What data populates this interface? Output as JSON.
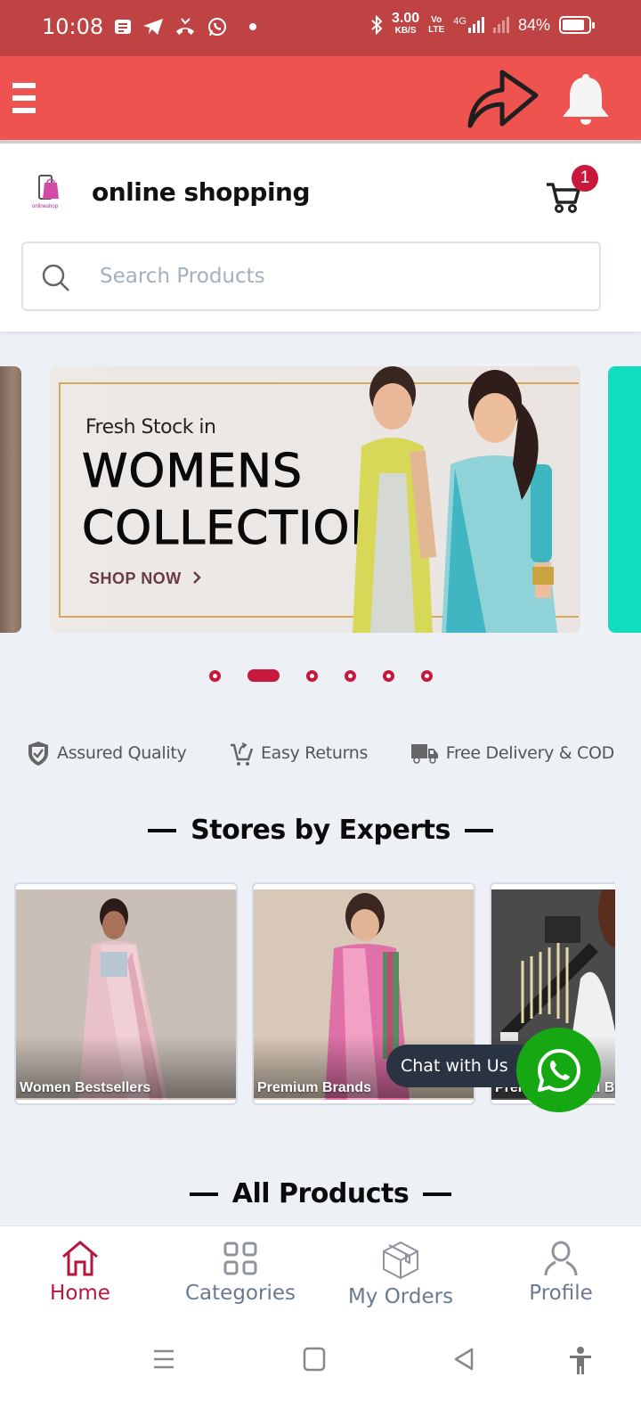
{
  "status_bar": {
    "time": "10:08",
    "notification_icons": [
      "message-icon",
      "telegram-icon",
      "missed-call-icon",
      "whatsapp-icon",
      "dot-icon"
    ],
    "net_speed_value": "3.00",
    "net_speed_unit": "KB/S",
    "volte_top": "Vo",
    "volte_bottom": "LTE",
    "network_type": "4G",
    "battery": "84%",
    "battery_level": 0.84
  },
  "app_bar": {
    "menu_icon": "hamburger-menu-icon",
    "share_icon": "share-arrow-icon",
    "bell_icon": "notification-bell-icon"
  },
  "header": {
    "logo_text": "onlineshop",
    "brand_title": "online shopping",
    "cart_count": "1",
    "search_placeholder": "Search Products",
    "search_value": ""
  },
  "banner": {
    "subtitle": "Fresh Stock in",
    "title_line1": "WOMENS",
    "title_line2": "COLLECTION",
    "cta": "SHOP NOW",
    "cta_icon": "chevron-right-icon",
    "slide_count": 6,
    "active_slide": 2
  },
  "features": [
    {
      "icon": "shield-check-icon",
      "label": "Assured Quality"
    },
    {
      "icon": "cart-return-icon",
      "label": "Easy Returns"
    },
    {
      "icon": "delivery-truck-icon",
      "label": "Free Delivery & COD"
    }
  ],
  "stores_section": {
    "title": "Stores by Experts",
    "cards": [
      {
        "label": "Women Bestsellers"
      },
      {
        "label": "Premium Brands"
      },
      {
        "label": "Premium Bridal Brands"
      }
    ]
  },
  "chat": {
    "label": "Chat with Us",
    "icon": "whatsapp-icon"
  },
  "products_section": {
    "title": "All Products"
  },
  "bottom_nav": {
    "items": [
      {
        "label": "Home",
        "icon": "home-icon",
        "active": true
      },
      {
        "label": "Categories",
        "icon": "grid-icon",
        "active": false
      },
      {
        "label": "My Orders",
        "icon": "box-icon",
        "active": false
      },
      {
        "label": "Profile",
        "icon": "user-icon",
        "active": false
      }
    ]
  },
  "system_nav": {
    "items": [
      "recents-icon",
      "home-square-icon",
      "back-icon",
      "accessibility-icon"
    ]
  },
  "colors": {
    "status_bar": "#c04343",
    "app_bar": "#ef5350",
    "accent": "#c8183c",
    "active_nav": "#b7163b",
    "whatsapp": "#16a812",
    "chat_pill": "#2a3342",
    "background": "#edf1f6"
  }
}
